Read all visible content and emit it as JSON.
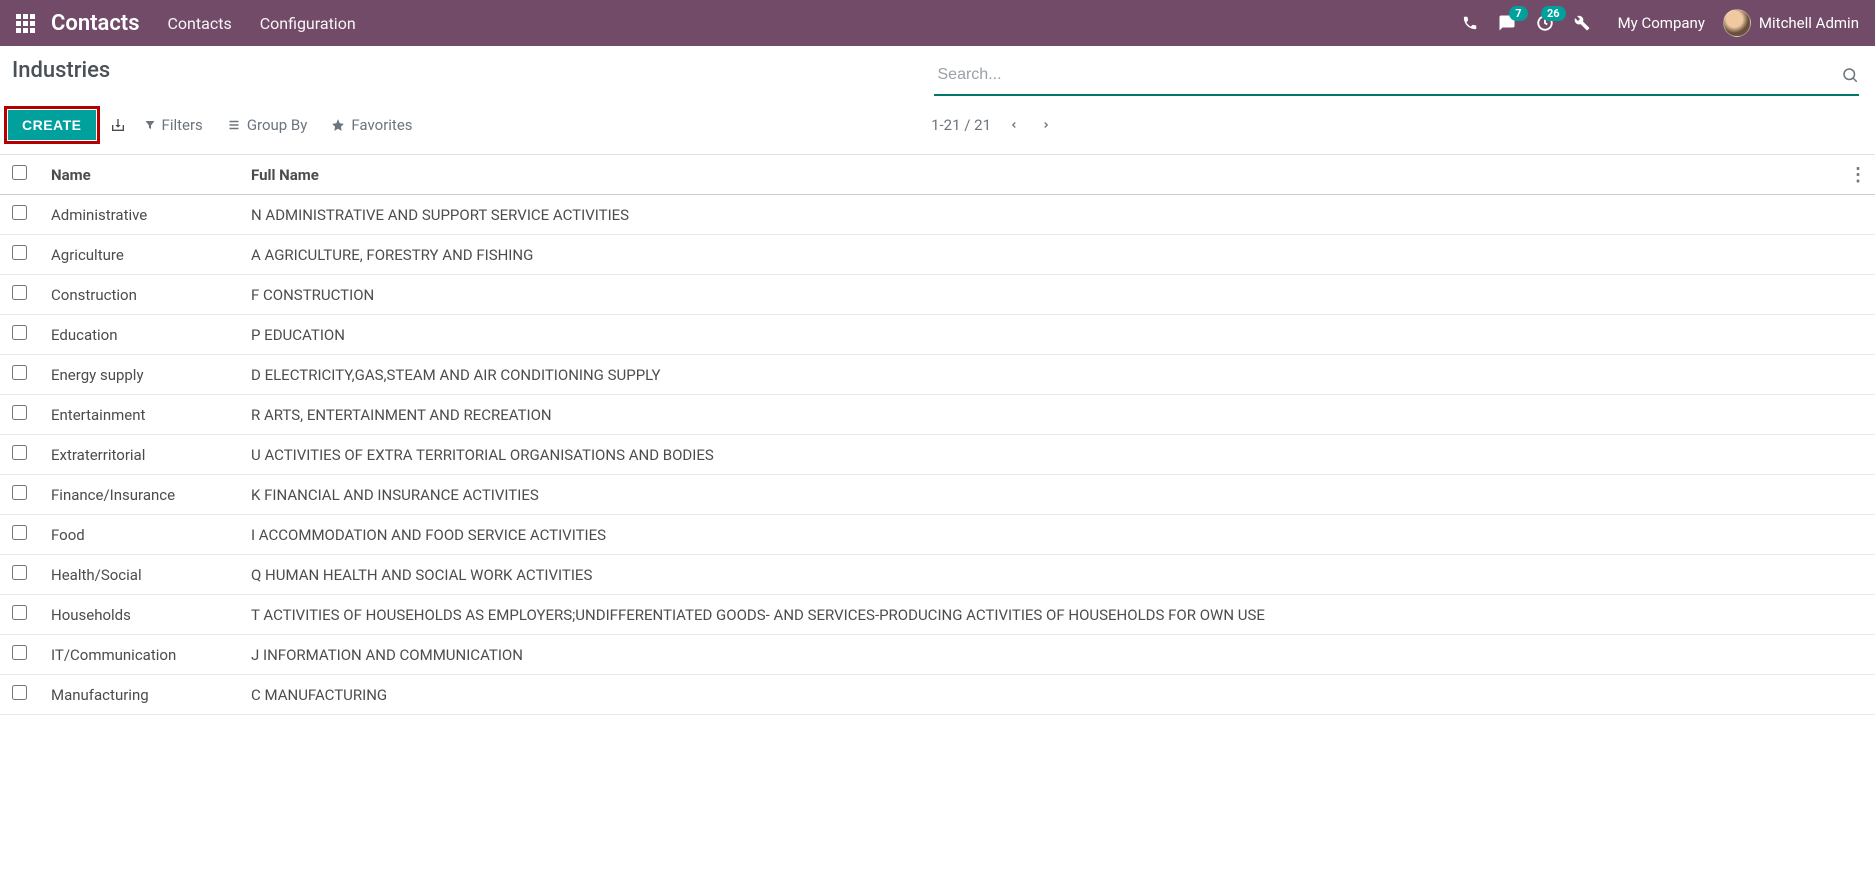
{
  "navbar": {
    "brand": "Contacts",
    "links": [
      "Contacts",
      "Configuration"
    ],
    "msg_badge": "7",
    "activity_badge": "26",
    "company": "My Company",
    "user": "Mitchell Admin"
  },
  "control": {
    "title": "Industries",
    "create_label": "CREATE",
    "search_placeholder": "Search...",
    "filters_label": "Filters",
    "group_by_label": "Group By",
    "favorites_label": "Favorites",
    "pager": "1-21 / 21"
  },
  "table": {
    "columns": [
      "Name",
      "Full Name"
    ],
    "rows": [
      {
        "name": "Administrative",
        "full": "N ADMINISTRATIVE AND SUPPORT SERVICE ACTIVITIES"
      },
      {
        "name": "Agriculture",
        "full": "A AGRICULTURE, FORESTRY AND FISHING"
      },
      {
        "name": "Construction",
        "full": "F CONSTRUCTION"
      },
      {
        "name": "Education",
        "full": "P EDUCATION"
      },
      {
        "name": "Energy supply",
        "full": "D ELECTRICITY,GAS,STEAM AND AIR CONDITIONING SUPPLY"
      },
      {
        "name": "Entertainment",
        "full": "R ARTS, ENTERTAINMENT AND RECREATION"
      },
      {
        "name": "Extraterritorial",
        "full": "U ACTIVITIES OF EXTRA TERRITORIAL ORGANISATIONS AND BODIES"
      },
      {
        "name": "Finance/Insurance",
        "full": "K FINANCIAL AND INSURANCE ACTIVITIES"
      },
      {
        "name": "Food",
        "full": "I ACCOMMODATION AND FOOD SERVICE ACTIVITIES"
      },
      {
        "name": "Health/Social",
        "full": "Q HUMAN HEALTH AND SOCIAL WORK ACTIVITIES"
      },
      {
        "name": "Households",
        "full": "T ACTIVITIES OF HOUSEHOLDS AS EMPLOYERS;UNDIFFERENTIATED GOODS- AND SERVICES-PRODUCING ACTIVITIES OF HOUSEHOLDS FOR OWN USE"
      },
      {
        "name": "IT/Communication",
        "full": "J INFORMATION AND COMMUNICATION"
      },
      {
        "name": "Manufacturing",
        "full": "C MANUFACTURING"
      }
    ]
  }
}
